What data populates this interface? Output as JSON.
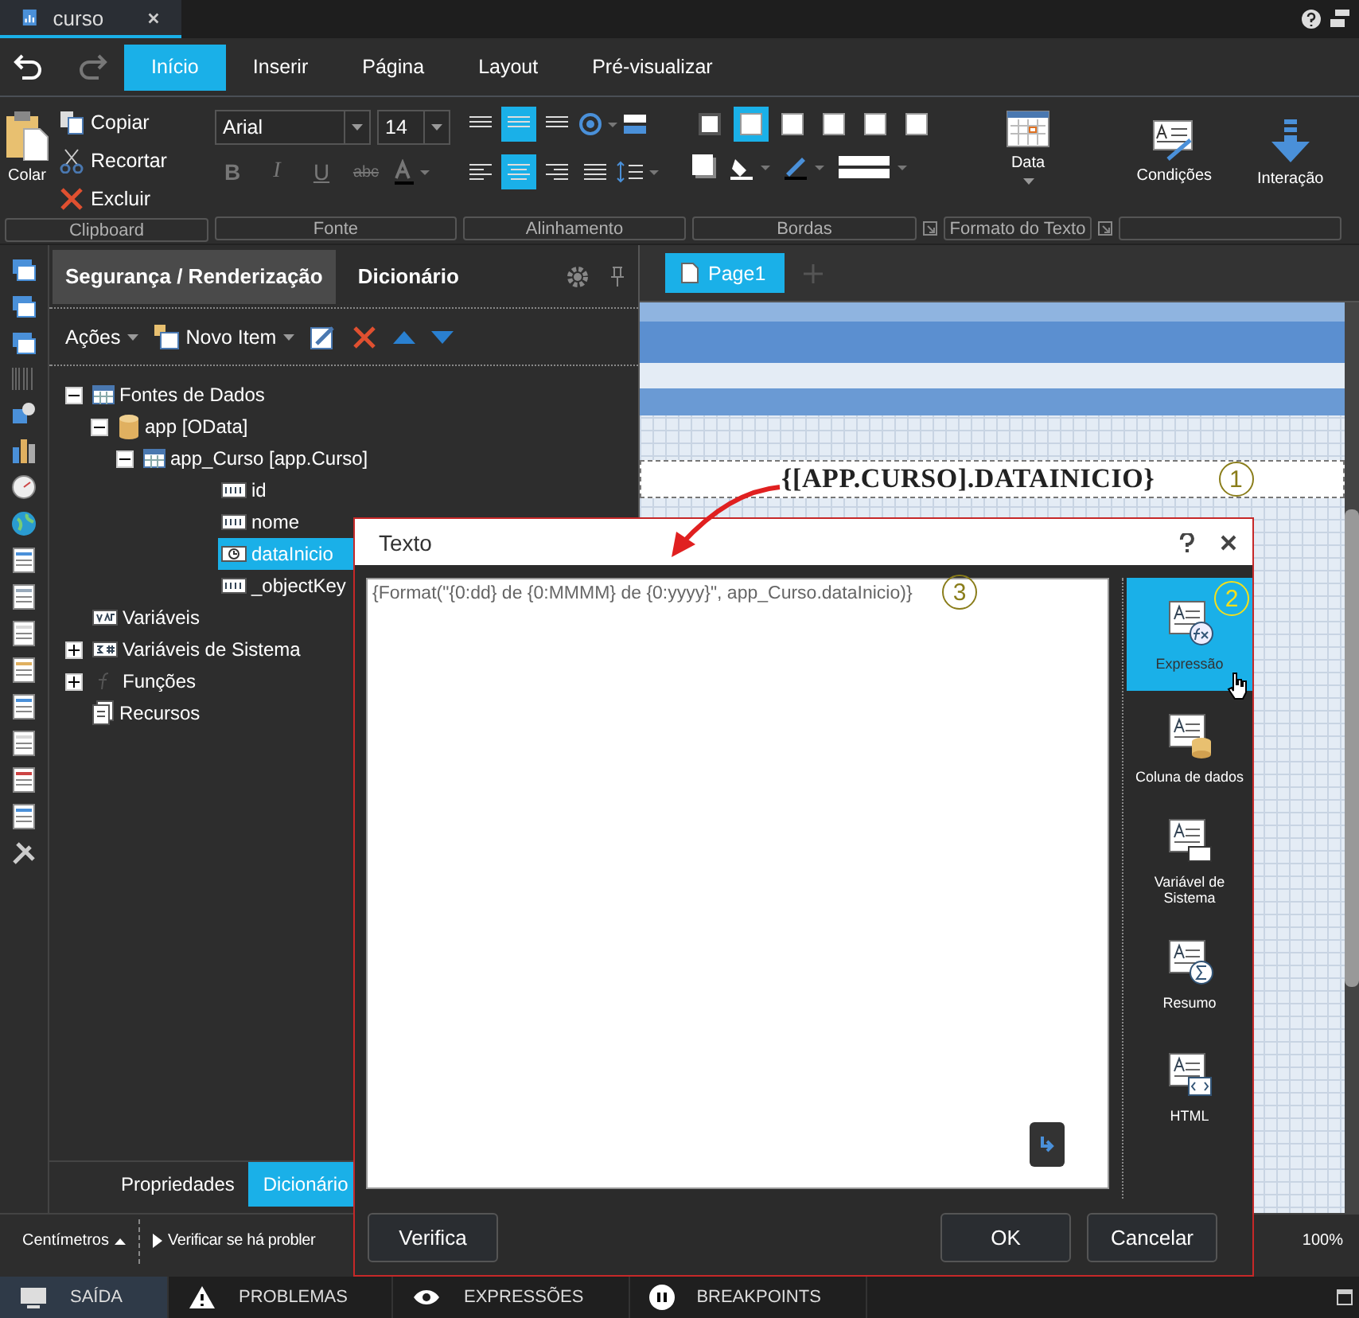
{
  "document_tab": {
    "title": "curso"
  },
  "ribbon": {
    "tabs": [
      {
        "label": "Início",
        "selected": true
      },
      {
        "label": "Inserir",
        "selected": false
      },
      {
        "label": "Página",
        "selected": false
      },
      {
        "label": "Layout",
        "selected": false
      },
      {
        "label": "Pré-visualizar",
        "selected": false
      }
    ],
    "clipboard": {
      "paste": "Colar",
      "actions": [
        {
          "label": "Copiar",
          "kind": "copy"
        },
        {
          "label": "Recortar",
          "kind": "cut"
        },
        {
          "label": "Excluir",
          "kind": "delete"
        }
      ]
    },
    "font": {
      "family": "Arial",
      "size": "14",
      "styles": [
        "B",
        "I",
        "U",
        "abc"
      ]
    },
    "vertical_alignment": [
      {
        "selected": false
      },
      {
        "selected": true
      },
      {
        "selected": false
      }
    ],
    "horizontal_alignment": [
      {
        "selected": false
      },
      {
        "selected": true
      },
      {
        "selected": false
      },
      {
        "selected": false
      }
    ],
    "borders": [
      {
        "selected": false
      },
      {
        "selected": true
      },
      {
        "selected": false
      },
      {
        "selected": false
      },
      {
        "selected": false
      },
      {
        "selected": false
      }
    ],
    "format_button": "Data",
    "condition_button": "Condições",
    "interaction_button": "Interação",
    "groups": [
      "Clipboard",
      "Fonte",
      "Alinhamento",
      "Bordas",
      "Formato do Texto"
    ]
  },
  "panel": {
    "tabs": [
      {
        "label": "Segurança / Renderização",
        "selected": true
      },
      {
        "label": "Dicionário",
        "selected": false
      }
    ],
    "toolbar": {
      "actions": "Ações",
      "new_item": "Novo Item"
    },
    "tree": [
      {
        "label": "Fontes de Dados",
        "kind": "table",
        "expanded": true,
        "selected": false,
        "children": [
          {
            "label": "app [OData]",
            "kind": "database",
            "expanded": true,
            "selected": false,
            "children": [
              {
                "label": "app_Curso [app.Curso]",
                "kind": "table",
                "expanded": true,
                "selected": false,
                "children": [
                  {
                    "label": "id",
                    "kind": "text",
                    "selected": false
                  },
                  {
                    "label": "nome",
                    "kind": "text",
                    "selected": false
                  },
                  {
                    "label": "dataInicio",
                    "kind": "datetime",
                    "selected": true
                  },
                  {
                    "label": "_objectKey",
                    "kind": "text",
                    "selected": false
                  }
                ]
              }
            ]
          }
        ]
      },
      {
        "label": "Variáveis",
        "kind": "variable",
        "selected": false
      },
      {
        "label": "Variáveis de Sistema",
        "kind": "system",
        "expanded": false,
        "selected": false
      },
      {
        "label": "Funções",
        "kind": "function",
        "expanded": false,
        "selected": false
      },
      {
        "label": "Recursos",
        "kind": "resource",
        "selected": false
      }
    ],
    "bottom_tabs": [
      {
        "label": "Propriedades",
        "selected": false
      },
      {
        "label": "Dicionário",
        "selected": true
      }
    ]
  },
  "status": {
    "units": "Centímetros",
    "check": "Verificar se há probler",
    "zoom": "100%"
  },
  "canvas": {
    "page_tab": "Page1",
    "text_component": "{[APP.CURSO].DATAINICIO}",
    "annotation": "1"
  },
  "dialog": {
    "title": "Texto",
    "expression": "{Format(\"{0:dd} de {0:MMMM} de {0:yyyy}\", app_Curso.dataInicio)}",
    "annotation": "3",
    "sidebar": [
      {
        "label": "Expressão",
        "kind": "expression",
        "selected": true
      },
      {
        "label": "Coluna de dados",
        "kind": "column",
        "selected": false
      },
      {
        "label": "Variável de Sistema",
        "kind": "system",
        "selected": false
      },
      {
        "label": "Resumo",
        "kind": "summary",
        "selected": false
      },
      {
        "label": "HTML",
        "kind": "html",
        "selected": false
      }
    ],
    "sidebar_annotation": "2",
    "check_button": "Verifica",
    "ok_button": "OK",
    "cancel_button": "Cancelar"
  },
  "bottom_bar": [
    {
      "label": "SAÍDA",
      "kind": "monitor",
      "selected": true
    },
    {
      "label": "PROBLEMAS",
      "kind": "warning",
      "selected": false
    },
    {
      "label": "EXPRESSÕES",
      "kind": "eye",
      "selected": false
    },
    {
      "label": "BREAKPOINTS",
      "kind": "pause",
      "selected": false
    }
  ]
}
